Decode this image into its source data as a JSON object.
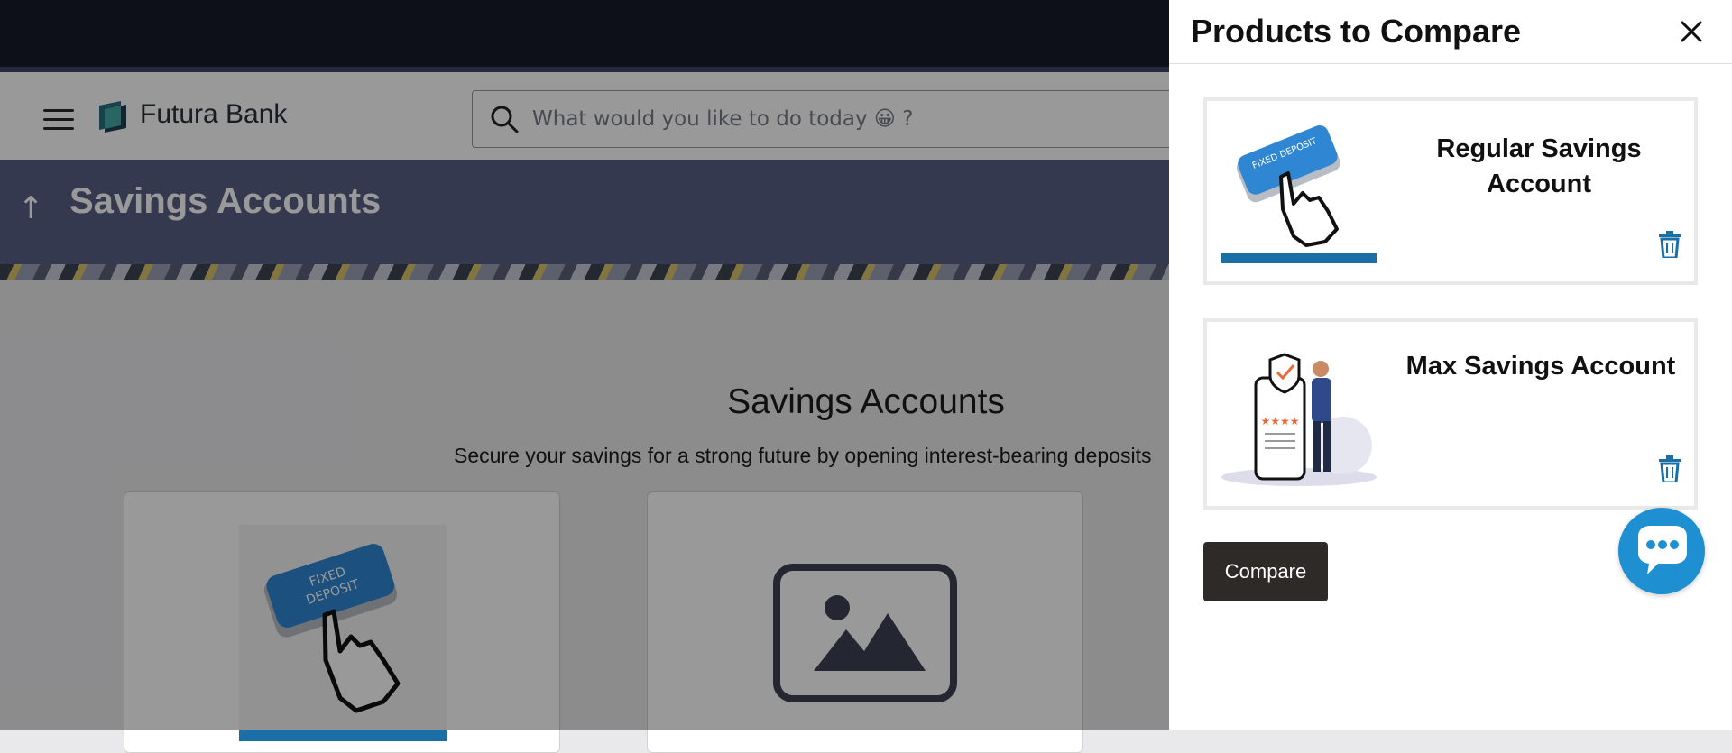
{
  "app": {
    "brand": "Futura Bank"
  },
  "search": {
    "placeholder": "What would you like to do today 😀 ?"
  },
  "page": {
    "title": "Savings Accounts",
    "content_title": "Savings Accounts",
    "content_subtitle": "Secure your savings for a strong future by opening interest-bearing deposits"
  },
  "panel": {
    "title": "Products to Compare",
    "products": [
      {
        "name": "Regular Savings Account",
        "image_label": "FIXED DEPOSIT"
      },
      {
        "name": "Max Savings Account"
      }
    ],
    "compare_label": "Compare"
  },
  "icons": {
    "menu": "hamburger-menu-icon",
    "search": "search-icon",
    "back": "up-arrow-icon",
    "close": "close-icon",
    "delete": "trash-icon",
    "chat": "chat-bubble-icon",
    "placeholder": "image-placeholder-icon"
  },
  "colors": {
    "topbar": "#161b2b",
    "title_band": "#586085",
    "accent": "#1e8fd0",
    "trash": "#1a6fa6",
    "compare_button": "#2d2a28"
  }
}
